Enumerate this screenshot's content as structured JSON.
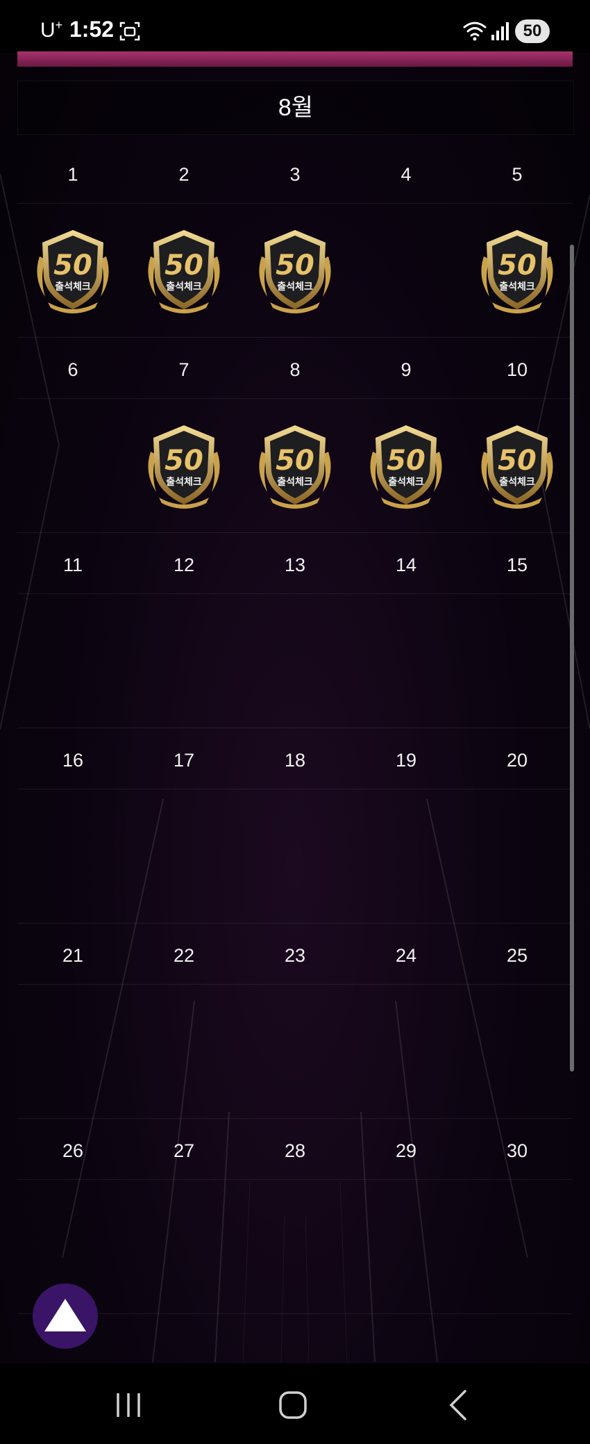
{
  "status_bar": {
    "carrier": "U",
    "carrier_sup": "+",
    "time": "1:52",
    "battery": "50"
  },
  "calendar": {
    "month_label": "8월",
    "stamp_text": "출석체크",
    "stamp_number": "50",
    "days": [
      {
        "day": "1",
        "stamped": true
      },
      {
        "day": "2",
        "stamped": true
      },
      {
        "day": "3",
        "stamped": true
      },
      {
        "day": "4",
        "stamped": false
      },
      {
        "day": "5",
        "stamped": true
      },
      {
        "day": "6",
        "stamped": false
      },
      {
        "day": "7",
        "stamped": true
      },
      {
        "day": "8",
        "stamped": true
      },
      {
        "day": "9",
        "stamped": true
      },
      {
        "day": "10",
        "stamped": true
      },
      {
        "day": "11",
        "stamped": false
      },
      {
        "day": "12",
        "stamped": false
      },
      {
        "day": "13",
        "stamped": false
      },
      {
        "day": "14",
        "stamped": false
      },
      {
        "day": "15",
        "stamped": false
      },
      {
        "day": "16",
        "stamped": false
      },
      {
        "day": "17",
        "stamped": false
      },
      {
        "day": "18",
        "stamped": false
      },
      {
        "day": "19",
        "stamped": false
      },
      {
        "day": "20",
        "stamped": false
      },
      {
        "day": "21",
        "stamped": false
      },
      {
        "day": "22",
        "stamped": false
      },
      {
        "day": "23",
        "stamped": false
      },
      {
        "day": "24",
        "stamped": false
      },
      {
        "day": "25",
        "stamped": false
      },
      {
        "day": "26",
        "stamped": false
      },
      {
        "day": "27",
        "stamped": false
      },
      {
        "day": "28",
        "stamped": false
      },
      {
        "day": "29",
        "stamped": false
      },
      {
        "day": "30",
        "stamped": false
      }
    ]
  },
  "icons": {
    "scroll_top": "triangle-up-icon",
    "nav_recents": "recents-icon",
    "nav_home": "home-icon",
    "nav_back": "back-icon"
  },
  "colors": {
    "accent_strip": "#8a2558",
    "fab": "#3a1466",
    "stamp_gold": "#c9a24a"
  }
}
